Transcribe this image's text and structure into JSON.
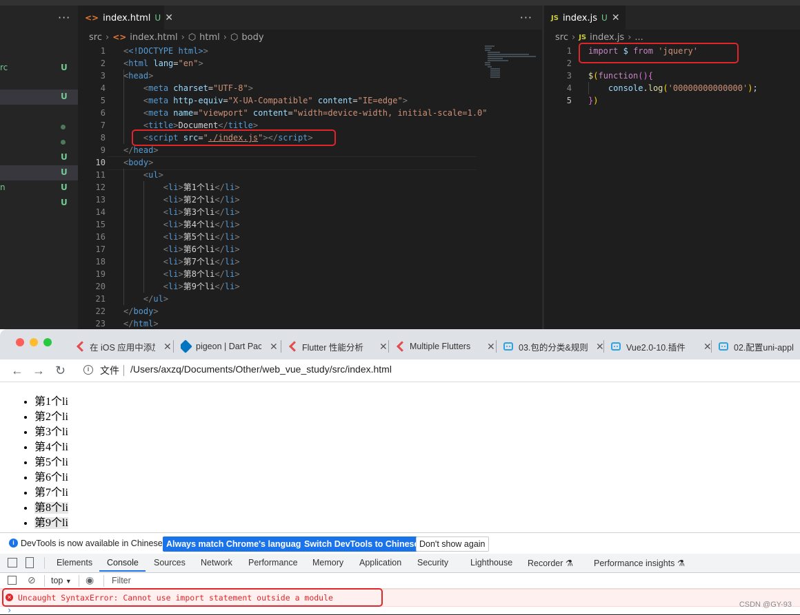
{
  "editor": {
    "sidebar": {
      "items": [
        {
          "label": "rc",
          "mark": "U"
        },
        {
          "label": "",
          "mark": "U"
        },
        {
          "label": "",
          "mark": "•"
        },
        {
          "label": "",
          "mark": "•"
        },
        {
          "label": "",
          "mark": "U"
        },
        {
          "label": "",
          "mark": "U"
        },
        {
          "label": "n",
          "mark": "U"
        },
        {
          "label": "",
          "mark": "U"
        }
      ]
    },
    "left_pane": {
      "tab": {
        "icon": "html-file-icon",
        "label": "index.html",
        "status": "U"
      },
      "breadcrumb": [
        "src",
        "index.html",
        "html",
        "body"
      ],
      "current_line": "10",
      "lines": [
        {
          "n": "1"
        },
        {
          "n": "2"
        },
        {
          "n": "3"
        },
        {
          "n": "4"
        },
        {
          "n": "5"
        },
        {
          "n": "6"
        },
        {
          "n": "7"
        },
        {
          "n": "8"
        },
        {
          "n": "9"
        },
        {
          "n": "10"
        },
        {
          "n": "11"
        },
        {
          "n": "12"
        },
        {
          "n": "13"
        },
        {
          "n": "14"
        },
        {
          "n": "15"
        },
        {
          "n": "16"
        },
        {
          "n": "17"
        },
        {
          "n": "18"
        },
        {
          "n": "19"
        },
        {
          "n": "20"
        },
        {
          "n": "21"
        },
        {
          "n": "22"
        },
        {
          "n": "23"
        }
      ],
      "code": {
        "doctype": "<!DOCTYPE html>",
        "html_lang": "en",
        "charset": "UTF-8",
        "http_equiv": "X-UA-Compatible",
        "http_equiv_content": "IE=edge",
        "viewport_name": "viewport",
        "viewport_content": "width=device-width, initial-scale=1.0",
        "title": "Document",
        "script_src": "./index.js",
        "li_items": [
          "第1个li",
          "第2个li",
          "第3个li",
          "第4个li",
          "第5个li",
          "第6个li",
          "第7个li",
          "第8个li",
          "第9个li"
        ]
      }
    },
    "right_pane": {
      "tab": {
        "icon": "js-file-icon",
        "label": "index.js",
        "status": "U"
      },
      "breadcrumb": [
        "src",
        "index.js",
        "..."
      ],
      "lines": [
        {
          "n": "1"
        },
        {
          "n": "2"
        },
        {
          "n": "3"
        },
        {
          "n": "4"
        },
        {
          "n": "5"
        }
      ],
      "code": {
        "import_kw": "import",
        "import_name": "$",
        "from_kw": "from",
        "module": "'jquery'",
        "log_arg": "'00000000000000'"
      }
    }
  },
  "browser": {
    "tabs": [
      {
        "icon": "flutter-icon",
        "label": "在 iOS 应用中添加"
      },
      {
        "icon": "dart-icon",
        "label": "pigeon | Dart Pac"
      },
      {
        "icon": "flutter-icon",
        "label": "Flutter 性能分析"
      },
      {
        "icon": "flutter-icon",
        "label": "Multiple Flutters"
      },
      {
        "icon": "bilibili-icon",
        "label": "03.包的分类&规则"
      },
      {
        "icon": "bilibili-icon",
        "label": "Vue2.0-10.插件"
      },
      {
        "icon": "bilibili-icon",
        "label": "02.配置uni-appl"
      }
    ],
    "address": {
      "scheme_label": "文件",
      "url": "/Users/axzq/Documents/Other/web_vue_study/src/index.html"
    },
    "page_list": [
      "第1个li",
      "第2个li",
      "第3个li",
      "第4个li",
      "第5个li",
      "第6个li",
      "第7个li",
      "第8个li",
      "第9个li"
    ]
  },
  "devtools": {
    "language_bar": {
      "message": "DevTools is now available in Chinese!",
      "btn_match": "Always match Chrome's language",
      "btn_switch": "Switch DevTools to Chinese",
      "btn_dismiss": "Don't show again"
    },
    "tabs": [
      "Elements",
      "Console",
      "Sources",
      "Network",
      "Performance",
      "Memory",
      "Application",
      "Security",
      "Lighthouse",
      "Recorder",
      "Performance insights"
    ],
    "active_tab": "Console",
    "console": {
      "context": "top",
      "filter_placeholder": "Filter",
      "error": "Uncaught SyntaxError: Cannot use import statement outside a module",
      "prompt": "›"
    }
  },
  "credit": "CSDN @GY-93",
  "colors": {
    "error": "#e0262a",
    "accent": "#1a73e8",
    "highlight_box": "#e0262a"
  }
}
